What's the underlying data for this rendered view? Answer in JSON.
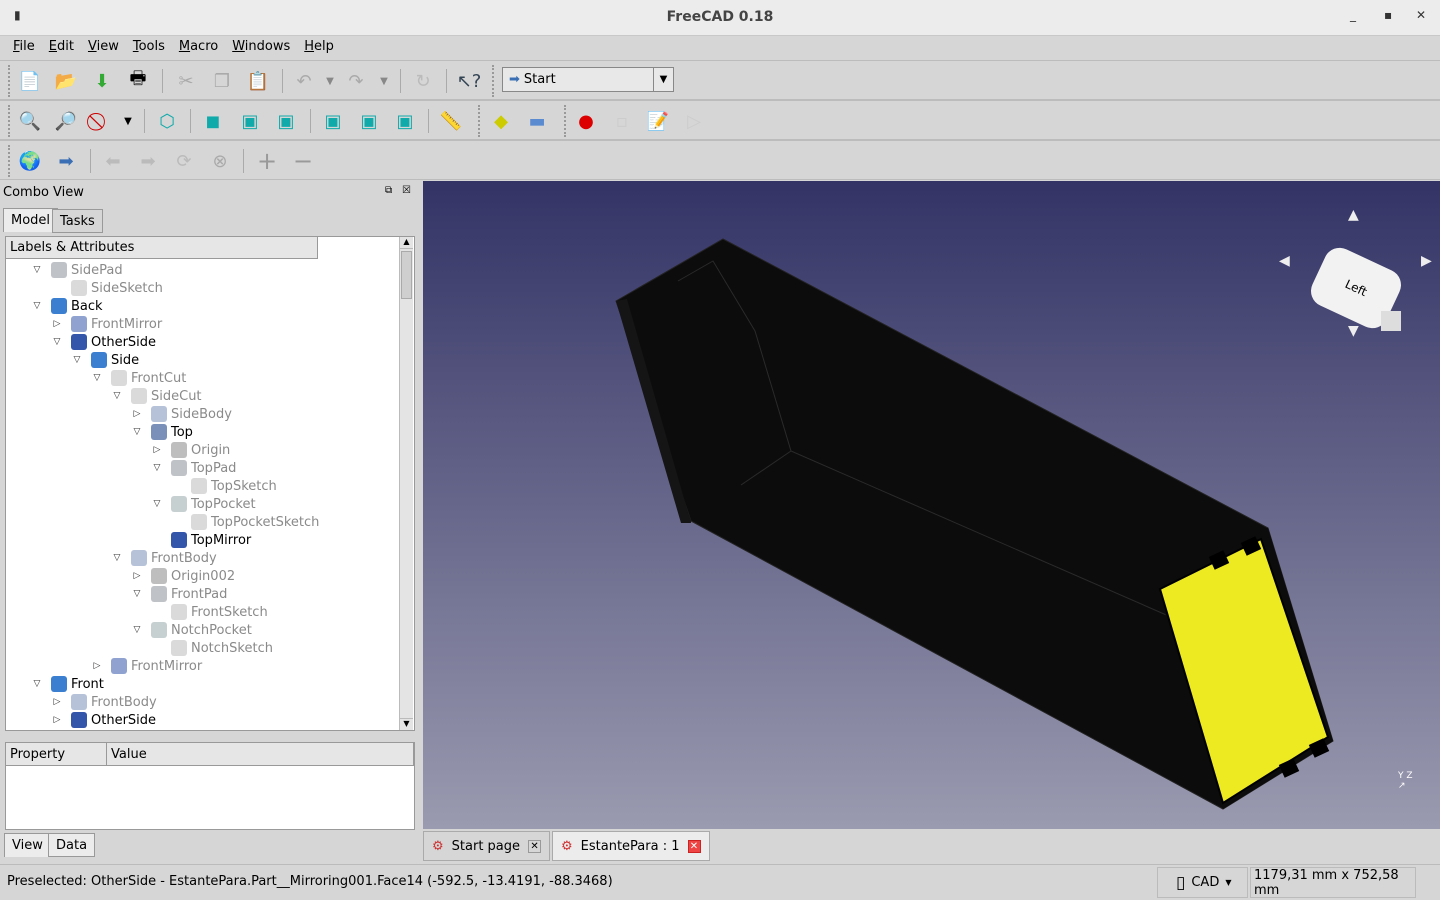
{
  "window": {
    "title": "FreeCAD 0.18"
  },
  "menu": [
    "File",
    "Edit",
    "View",
    "Tools",
    "Macro",
    "Windows",
    "Help"
  ],
  "toolbar": {
    "workbench": "Start"
  },
  "combo": {
    "title": "Combo View",
    "tabs": [
      "Model",
      "Tasks"
    ],
    "tree_header": "Labels & Attributes",
    "tree": [
      {
        "label": "SidePad",
        "level": 0,
        "state": "expanded",
        "dim": true,
        "icon": "pad-icon"
      },
      {
        "label": "SideSketch",
        "level": 1,
        "state": "leaf",
        "dim": true,
        "icon": "sketch-icon"
      },
      {
        "label": "Back",
        "level": 0,
        "state": "expanded",
        "dim": false,
        "icon": "part-icon"
      },
      {
        "label": "FrontMirror",
        "level": 1,
        "state": "collapsed",
        "dim": true,
        "icon": "mirror-icon"
      },
      {
        "label": "OtherSide",
        "level": 1,
        "state": "expanded",
        "dim": false,
        "icon": "mirror-icon"
      },
      {
        "label": "Side",
        "level": 2,
        "state": "expanded",
        "dim": false,
        "icon": "part-icon"
      },
      {
        "label": "FrontCut",
        "level": 3,
        "state": "expanded",
        "dim": true,
        "icon": "cut-icon"
      },
      {
        "label": "SideCut",
        "level": 4,
        "state": "expanded",
        "dim": true,
        "icon": "cut-icon"
      },
      {
        "label": "SideBody",
        "level": 5,
        "state": "collapsed",
        "dim": true,
        "icon": "body-icon"
      },
      {
        "label": "Top",
        "level": 5,
        "state": "expanded",
        "dim": false,
        "icon": "body-icon"
      },
      {
        "label": "Origin",
        "level": 6,
        "state": "collapsed",
        "dim": true,
        "icon": "origin-icon"
      },
      {
        "label": "TopPad",
        "level": 6,
        "state": "expanded",
        "dim": true,
        "icon": "pad-icon"
      },
      {
        "label": "TopSketch",
        "level": 7,
        "state": "leaf",
        "dim": true,
        "icon": "sketch-icon"
      },
      {
        "label": "TopPocket",
        "level": 6,
        "state": "expanded",
        "dim": true,
        "icon": "pocket-icon"
      },
      {
        "label": "TopPocketSketch",
        "level": 7,
        "state": "leaf",
        "dim": true,
        "icon": "sketch-icon"
      },
      {
        "label": "TopMirror",
        "level": 6,
        "state": "leaf",
        "dim": false,
        "icon": "mirror-icon"
      },
      {
        "label": "FrontBody",
        "level": 4,
        "state": "expanded",
        "dim": true,
        "icon": "body-icon"
      },
      {
        "label": "Origin002",
        "level": 5,
        "state": "collapsed",
        "dim": true,
        "icon": "origin-icon"
      },
      {
        "label": "FrontPad",
        "level": 5,
        "state": "expanded",
        "dim": true,
        "icon": "pad-icon"
      },
      {
        "label": "FrontSketch",
        "level": 6,
        "state": "leaf",
        "dim": true,
        "icon": "sketch-icon"
      },
      {
        "label": "NotchPocket",
        "level": 5,
        "state": "expanded",
        "dim": true,
        "icon": "pocket-icon"
      },
      {
        "label": "NotchSketch",
        "level": 6,
        "state": "leaf",
        "dim": true,
        "icon": "sketch-icon"
      },
      {
        "label": "FrontMirror",
        "level": 3,
        "state": "collapsed",
        "dim": true,
        "icon": "mirror-icon"
      },
      {
        "label": "Front",
        "level": 0,
        "state": "expanded",
        "dim": false,
        "icon": "part-icon"
      },
      {
        "label": "FrontBody",
        "level": 1,
        "state": "collapsed",
        "dim": true,
        "icon": "body-icon"
      },
      {
        "label": "OtherSide",
        "level": 1,
        "state": "collapsed",
        "dim": false,
        "icon": "mirror-icon"
      }
    ],
    "property_headers": [
      "Property",
      "Value"
    ],
    "bottom_tabs": [
      "View",
      "Data"
    ]
  },
  "navcube": {
    "face": "Left"
  },
  "doc_tabs": [
    "Start page",
    "EstantePara : 1"
  ],
  "status": {
    "message": "Preselected: OtherSide - EstantePara.Part__Mirroring001.Face14 (-592.5, -13.4191, -88.3468)",
    "nav_style": "CAD",
    "dimensions": "1179,31 mm x 752,58 mm"
  },
  "colors": {
    "selection": "#eeea22",
    "background_top": "#333366",
    "background_bottom": "#9a9ab0"
  }
}
